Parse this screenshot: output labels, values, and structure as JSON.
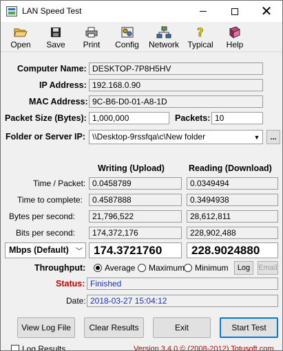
{
  "window": {
    "title": "LAN Speed Test",
    "minimize": "",
    "maximize": "",
    "close": "✕"
  },
  "toolbar": {
    "open": "Open",
    "save": "Save",
    "print": "Print",
    "config": "Config",
    "network": "Network",
    "typical": "Typical",
    "help": "Help"
  },
  "info": {
    "computer_name_label": "Computer Name:",
    "computer_name": "DESKTOP-7P8H5HV",
    "ip_label": "IP Address:",
    "ip": "192.168.0.90",
    "mac_label": "MAC Address:",
    "mac": "9C-B6-D0-01-A8-1D",
    "packet_size_label": "Packet Size (Bytes):",
    "packet_size": "1,000,000",
    "packets_label": "Packets:",
    "packets": "10",
    "folder_label": "Folder or Server IP:",
    "folder": "\\\\Desktop-9rssfqa\\c\\New folder",
    "browse": "..."
  },
  "results": {
    "writing_header": "Writing (Upload)",
    "reading_header": "Reading (Download)",
    "rows": [
      {
        "label": "Time / Packet:",
        "write": "0.0458789",
        "read": "0.0349494"
      },
      {
        "label": "Time to complete:",
        "write": "0.4587888",
        "read": "0.3494938"
      },
      {
        "label": "Bytes per second:",
        "write": "21,796,522",
        "read": "28,612,811"
      },
      {
        "label": "Bits per second:",
        "write": "174,372,176",
        "read": "228,902,488"
      }
    ],
    "unit_select": "Mbps (Default)",
    "write_big": "174.3721760",
    "read_big": "228.9024880"
  },
  "throughput": {
    "label": "Throughput:",
    "average": "Average",
    "maximum": "Maximum",
    "minimum": "Minimum",
    "selected": "Average",
    "log": "Log",
    "email": "Email"
  },
  "status": {
    "label": "Status:",
    "value": "Finished",
    "label_color": "#c00000"
  },
  "date": {
    "label": "Date:",
    "value": "2018-03-27 15:04:12"
  },
  "buttons": {
    "view_log": "View Log File",
    "clear": "Clear Results",
    "exit": "Exit",
    "start": "Start Test"
  },
  "footer": {
    "log_results": "Log Results",
    "version": "Version 3.4.0  © (2008-2012) Totusoft.com"
  },
  "colors": {
    "accent": "#0078d7",
    "value_blue": "#1c2fbd",
    "status_red": "#c00000",
    "version_red": "#c00000"
  }
}
